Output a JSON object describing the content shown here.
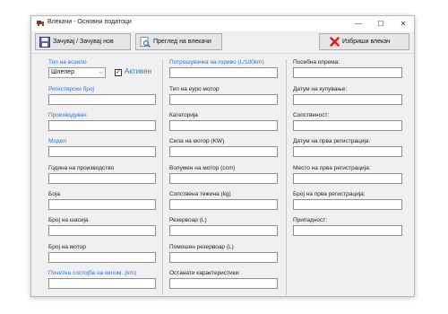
{
  "window": {
    "title": "Влекачи - Основни податоци",
    "controls": {
      "minimize": "—",
      "maximize": "☐",
      "close": "✕"
    }
  },
  "toolbar": {
    "save_label": "Зачувај / Зачувај нов",
    "browse_label": "Преглед на влекачи",
    "delete_label": "Избриши влекач"
  },
  "column1": {
    "type_label": "Тип на возило",
    "type_value": "Шлепер",
    "active_label": "Активен",
    "registration": "Регистерски број",
    "manufacturer": "Производувач",
    "model": "Модел",
    "year": "Година на производство",
    "color": "Боја",
    "chassis": "Број на шасија",
    "engine_no": "Број на мотор",
    "odometer": "Почетна состојба на килом. (km)"
  },
  "column2": {
    "fuel_consumption": "Потрошувачка на гориво (L/100km)",
    "euro_engine": "Тип на еуро мотор",
    "category": "Категорија",
    "engine_power": "Сила на мотор (KW)",
    "engine_volume": "Волумен на мотор (ccm)",
    "own_weight": "Сопствена тежина (kg)",
    "tank": "Резервоар (L)",
    "aux_tank": "Помошен резервоар (L)",
    "other_specs": "Останати карактеристики:"
  },
  "column3": {
    "special_equipment": "Посебна опрема:",
    "purchase_date": "Датум на купување:",
    "ownership": "Сопственост:",
    "first_reg_date": "Датум на прва регистрација:",
    "first_reg_place": "Место на прва регистрација:",
    "first_reg_number": "Број на прва регистрација:",
    "affiliation": "Припадност:"
  }
}
